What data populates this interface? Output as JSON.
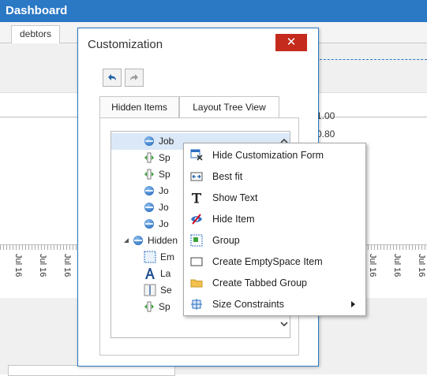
{
  "app": {
    "title": "Dashboard",
    "tabs": [
      {
        "label": "debtors"
      }
    ]
  },
  "chart_bg": {
    "y_label_1": "1.00",
    "y_label_2": "0.80",
    "x_label": "Jul 16"
  },
  "customization": {
    "title": "Customization",
    "close_glyph": "✕",
    "tabs": [
      {
        "label": "Hidden Items"
      },
      {
        "label": "Layout Tree View",
        "active": true
      }
    ],
    "tree_items": [
      {
        "label": "Job",
        "icon": "layout-item-icon",
        "selected": true
      },
      {
        "label": "Sp",
        "icon": "splitter-icon"
      },
      {
        "label": "Sp",
        "icon": "splitter-icon"
      },
      {
        "label": "Jo",
        "icon": "layout-item-icon"
      },
      {
        "label": "Jo",
        "icon": "layout-item-icon"
      },
      {
        "label": "Jo",
        "icon": "layout-item-icon"
      },
      {
        "label": "Hidden",
        "icon": "layout-item-icon",
        "expanded": true
      },
      {
        "label": "Em",
        "icon": "empty-space-icon"
      },
      {
        "label": "La",
        "icon": "label-icon"
      },
      {
        "label": "Se",
        "icon": "separator-icon"
      },
      {
        "label": "Sp",
        "icon": "splitter-icon"
      }
    ]
  },
  "context_menu": {
    "items": [
      {
        "label": "Hide Customization Form",
        "icon": "hide-form-icon"
      },
      {
        "label": "Best fit",
        "icon": "best-fit-icon"
      },
      {
        "label": "Show Text",
        "icon": "show-text-icon"
      },
      {
        "label": "Hide Item",
        "icon": "hide-item-icon"
      },
      {
        "label": "Group",
        "icon": "group-icon"
      },
      {
        "label": "Create EmptySpace Item",
        "icon": "empty-space-icon"
      },
      {
        "label": "Create Tabbed Group",
        "icon": "folder-icon"
      },
      {
        "label": "Size Constraints",
        "icon": "size-constraints-icon",
        "submenu": true
      }
    ]
  },
  "colors": {
    "accent": "#2b78c5",
    "close": "#c42b1c",
    "selection": "#dbe8f7"
  }
}
